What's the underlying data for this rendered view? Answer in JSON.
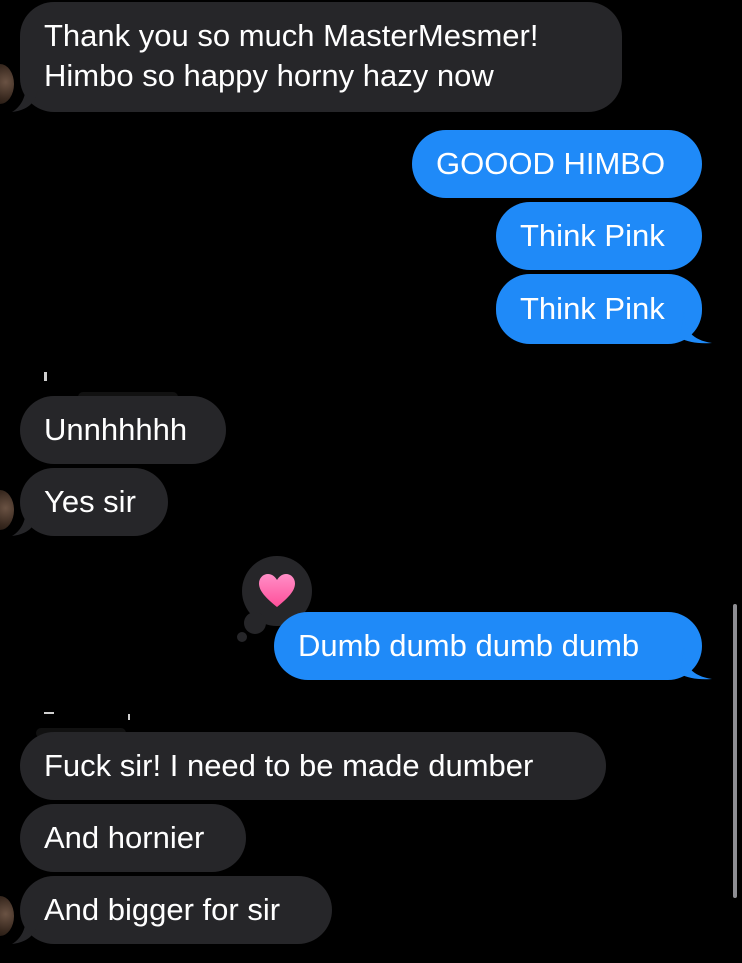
{
  "conversation": {
    "messages": [
      {
        "id": "m1",
        "direction": "incoming",
        "text": "Thank you so much MasterMesmer!\nHimbo so happy horny hazy now"
      },
      {
        "id": "m2",
        "direction": "outgoing",
        "text": "GOOOD HIMBO"
      },
      {
        "id": "m3",
        "direction": "outgoing",
        "text": "Think Pink"
      },
      {
        "id": "m4",
        "direction": "outgoing",
        "text": "Think Pink"
      },
      {
        "id": "m5",
        "direction": "incoming",
        "text": "Unnhhhhh"
      },
      {
        "id": "m6",
        "direction": "incoming",
        "text": "Yes sir"
      },
      {
        "id": "m7",
        "direction": "outgoing",
        "text": "Dumb dumb dumb dumb",
        "tapback": "heart"
      },
      {
        "id": "m8",
        "direction": "incoming",
        "text": "Fuck sir! I need to be made dumber"
      },
      {
        "id": "m9",
        "direction": "incoming",
        "text": "And hornier"
      },
      {
        "id": "m10",
        "direction": "incoming",
        "text": "And bigger for sir"
      }
    ]
  },
  "colors": {
    "background": "#000000",
    "incoming_bubble": "#262629",
    "outgoing_bubble": "#1f8af8",
    "text": "#ffffff",
    "tapback_heart": "#ff5fa8"
  },
  "icons": {
    "tapback": "heart-icon",
    "avatar": "contact-avatar"
  }
}
